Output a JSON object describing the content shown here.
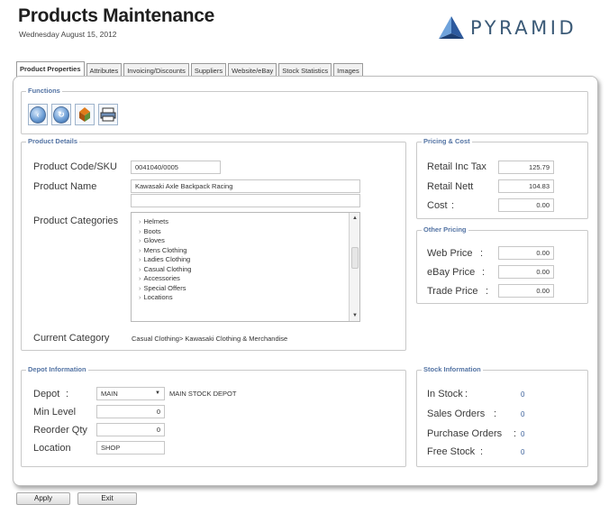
{
  "header": {
    "title": "Products Maintenance",
    "date": "Wednesday August 15, 2012",
    "logo_text": "PYRAMID",
    "accent_color": "#3b6fb6"
  },
  "tabs": [
    {
      "label": "Product Properties",
      "active": true
    },
    {
      "label": "Attributes"
    },
    {
      "label": "Invoicing/Discounts"
    },
    {
      "label": "Suppliers"
    },
    {
      "label": "Website/eBay"
    },
    {
      "label": "Stock Statistics"
    },
    {
      "label": "Images"
    }
  ],
  "functions": {
    "legend": "Functions",
    "buttons": [
      "back-icon",
      "refresh-icon",
      "product-icon",
      "print-icon"
    ]
  },
  "product_details": {
    "legend": "Product Details",
    "code_label": "Product Code/SKU",
    "code_value": "0041040/0005",
    "name_label": "Product Name",
    "name_value": "Kawasaki Axle Backpack Racing",
    "categories_label": "Product Categories",
    "categories": [
      "Helmets",
      "Boots",
      "Gloves",
      "Mens Clothing",
      "Ladies Clothing",
      "Casual Clothing",
      "Accessories",
      "Special Offers",
      "Locations"
    ],
    "current_label": "Current Category",
    "current_value": "Casual Clothing> Kawasaki Clothing & Merchandise"
  },
  "pricing": {
    "legend": "Pricing & Cost",
    "retail_inc_label": "Retail Inc Tax",
    "retail_inc_value": "125.79",
    "retail_nett_label": "Retail Nett",
    "retail_nett_value": "104.83",
    "cost_label": "Cost",
    "cost_value": "0.00"
  },
  "other_pricing": {
    "legend": "Other Pricing",
    "web_label": "Web Price",
    "web_value": "0.00",
    "ebay_label": "eBay Price",
    "ebay_value": "0.00",
    "trade_label": "Trade Price",
    "trade_value": "0.00"
  },
  "depot": {
    "legend": "Depot Information",
    "depot_label": "Depot",
    "depot_value": "MAIN",
    "depot_name": "MAIN STOCK DEPOT",
    "min_label": "Min Level",
    "min_value": "0",
    "reorder_label": "Reorder Qty",
    "reorder_value": "0",
    "location_label": "Location",
    "location_value": "SHOP"
  },
  "stock": {
    "legend": "Stock Information",
    "in_stock_label": "In Stock",
    "in_stock_value": "0",
    "sales_label": "Sales Orders",
    "sales_value": "0",
    "purchase_label": "Purchase Orders",
    "purchase_value": "0",
    "free_label": "Free Stock",
    "free_value": "0"
  },
  "footer": {
    "apply_label": "Apply",
    "exit_label": "Exit"
  }
}
